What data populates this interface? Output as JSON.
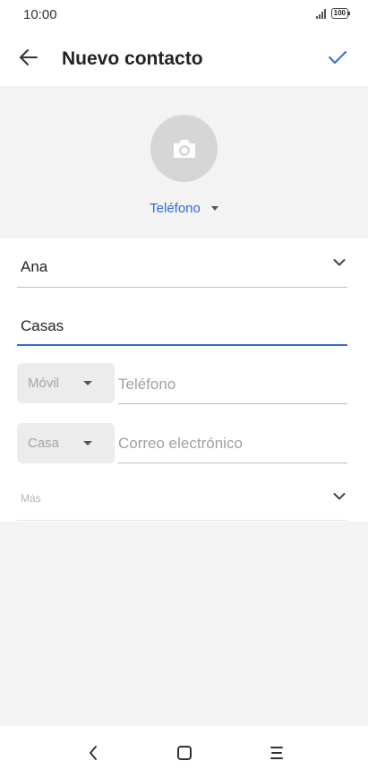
{
  "status_bar": {
    "time": "10:00",
    "battery": "100",
    "signal_icon": "signal-bars-icon"
  },
  "app_bar": {
    "back_icon": "arrow-left-icon",
    "title": "Nuevo contacto",
    "confirm_icon": "checkmark-icon",
    "accent_color": "#2f6bd8"
  },
  "photo": {
    "icon": "camera-icon",
    "account_label": "Teléfono"
  },
  "form": {
    "first_name": "Ana",
    "last_name": "Casas",
    "phone_type": "Móvil",
    "phone_placeholder": "Teléfono",
    "email_type": "Casa",
    "email_placeholder": "Correo electrónico",
    "more_label": "Más"
  },
  "nav_bar": {
    "back_icon": "nav-back-icon",
    "home_icon": "nav-home-icon",
    "menu_icon": "nav-menu-icon"
  }
}
